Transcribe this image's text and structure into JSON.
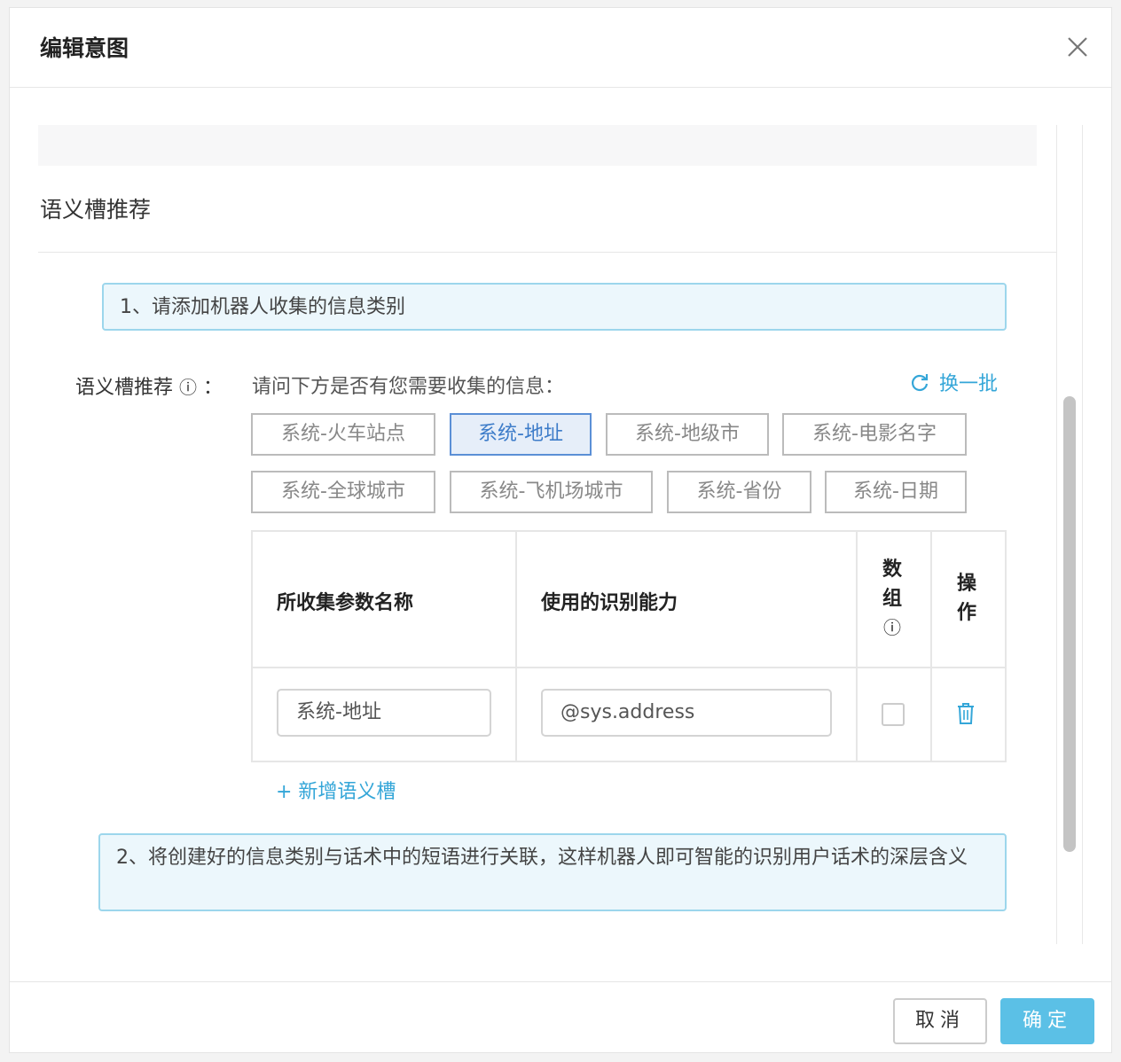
{
  "dialog": {
    "title": "编辑意图",
    "close_icon": "close-icon",
    "section_title": "语义槽推荐",
    "step1": "1、请添加机器人收集的信息类别",
    "rec_label": "语义槽推荐",
    "rec_info": "ⓘ",
    "rec_colon": "：",
    "rec_question": "请问下方是否有您需要收集的信息：",
    "refresh_label": "换一批",
    "tags": [
      {
        "label": "系统-火车站点",
        "selected": false
      },
      {
        "label": "系统-地址",
        "selected": true
      },
      {
        "label": "系统-地级市",
        "selected": false
      },
      {
        "label": "系统-电影名字",
        "selected": false
      },
      {
        "label": "系统-全球城市",
        "selected": false
      },
      {
        "label": "系统-飞机场城市",
        "selected": false
      },
      {
        "label": "系统-省份",
        "selected": false
      },
      {
        "label": "系统-日期",
        "selected": false
      }
    ],
    "table": {
      "headers": {
        "name": "所收集参数名称",
        "ability": "使用的识别能力",
        "array_1": "数",
        "array_2": "组",
        "array_info": "ⓘ",
        "op_1": "操",
        "op_2": "作"
      },
      "rows": [
        {
          "name": "系统-地址",
          "ability": "@sys.address",
          "is_array": false,
          "delete_icon": "trash-icon"
        }
      ]
    },
    "add_slot": "+ 新增语义槽",
    "step2": "2、将创建好的信息类别与话术中的短语进行关联，这样机器人即可智能的识别用户话术的深层含义",
    "cancel_label": "取消",
    "ok_label": "确定",
    "colors": {
      "accent": "#34a6d8",
      "ok_button": "#5bc0e6",
      "info_bg": "#ecf7fc",
      "selected_tag": "#3d7cc9"
    }
  }
}
